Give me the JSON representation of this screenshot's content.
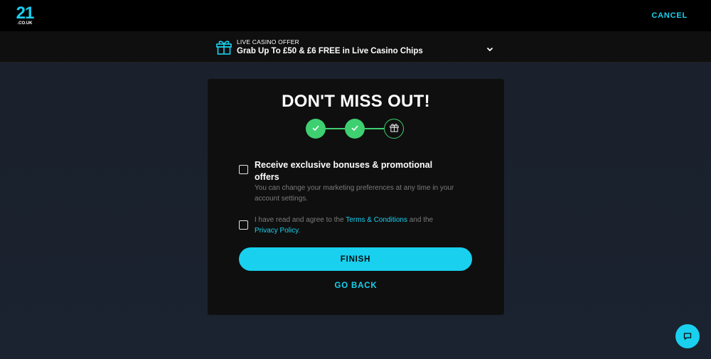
{
  "header": {
    "logo_number": "21",
    "logo_domain": ".CO.UK",
    "cancel_label": "CANCEL"
  },
  "offer": {
    "label": "LIVE CASINO OFFER",
    "headline": "Grab Up To £50 & £6 FREE in Live Casino Chips",
    "icon": "gift-icon",
    "toggle_icon": "chevron-down-icon"
  },
  "card": {
    "title": "DON'T MISS OUT!",
    "steps": [
      {
        "state": "done",
        "icon": "check-icon"
      },
      {
        "state": "done",
        "icon": "check-icon"
      },
      {
        "state": "current",
        "icon": "gift-icon"
      }
    ],
    "promo": {
      "title": "Receive exclusive bonuses & promotional offers",
      "subtitle": "You can change your marketing preferences at any time in your account settings.",
      "checked": false
    },
    "terms": {
      "prefix": "I have read and agree to the ",
      "terms_link": "Terms & Conditions",
      "middle": " and the ",
      "privacy_link": "Privacy Policy",
      "suffix": ".",
      "checked": false
    },
    "finish_label": "FINISH",
    "go_back_label": "GO BACK"
  },
  "chat": {
    "icon": "chat-icon"
  },
  "colors": {
    "accent": "#19d0ef",
    "success": "#3ecf71",
    "card_bg": "#0f0f0f",
    "page_bg": "#1b2230"
  }
}
